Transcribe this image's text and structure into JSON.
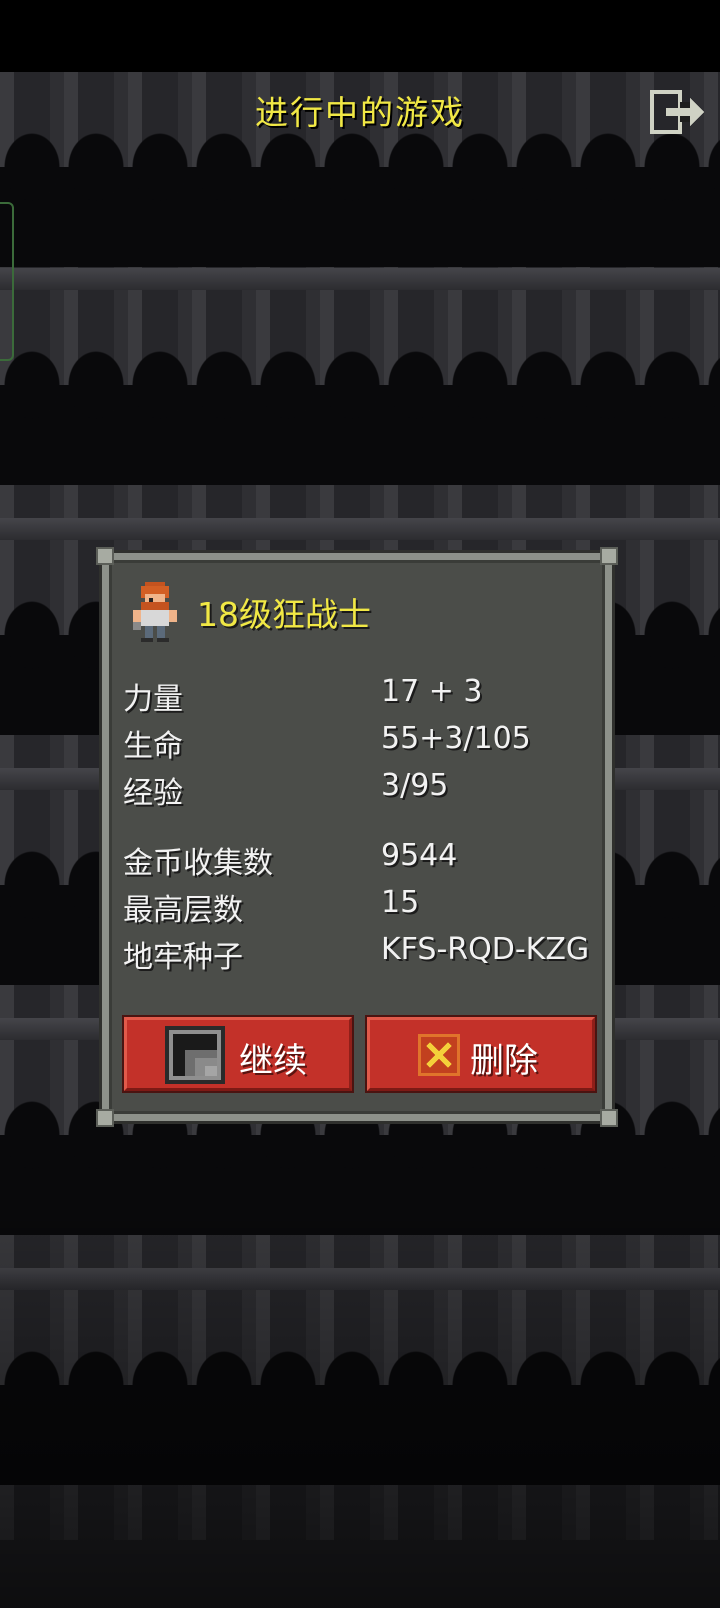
{
  "header": {
    "title": "进行中的游戏",
    "exit_icon": "exit-door-icon"
  },
  "hero": {
    "title": "18级狂战士",
    "avatar_icon": "berserker-avatar-icon"
  },
  "stats": [
    {
      "label": "力量",
      "value": "17 + 3"
    },
    {
      "label": "生命",
      "value": "55+3/105"
    },
    {
      "label": "经验",
      "value": "3/95"
    }
  ],
  "records": [
    {
      "label": "金币收集数",
      "value": "9544"
    },
    {
      "label": "最高层数",
      "value": "15"
    },
    {
      "label": "地牢种子",
      "value": "KFS-RQD-KZG"
    }
  ],
  "buttons": {
    "continue_label": "继续",
    "continue_icon": "stairs-icon",
    "delete_label": "删除",
    "delete_icon": "close-x-icon"
  },
  "colors": {
    "title_yellow": "#f1e845",
    "button_red": "#c33129",
    "panel_bg": "#4b4d49",
    "panel_border": "#8d918a"
  }
}
